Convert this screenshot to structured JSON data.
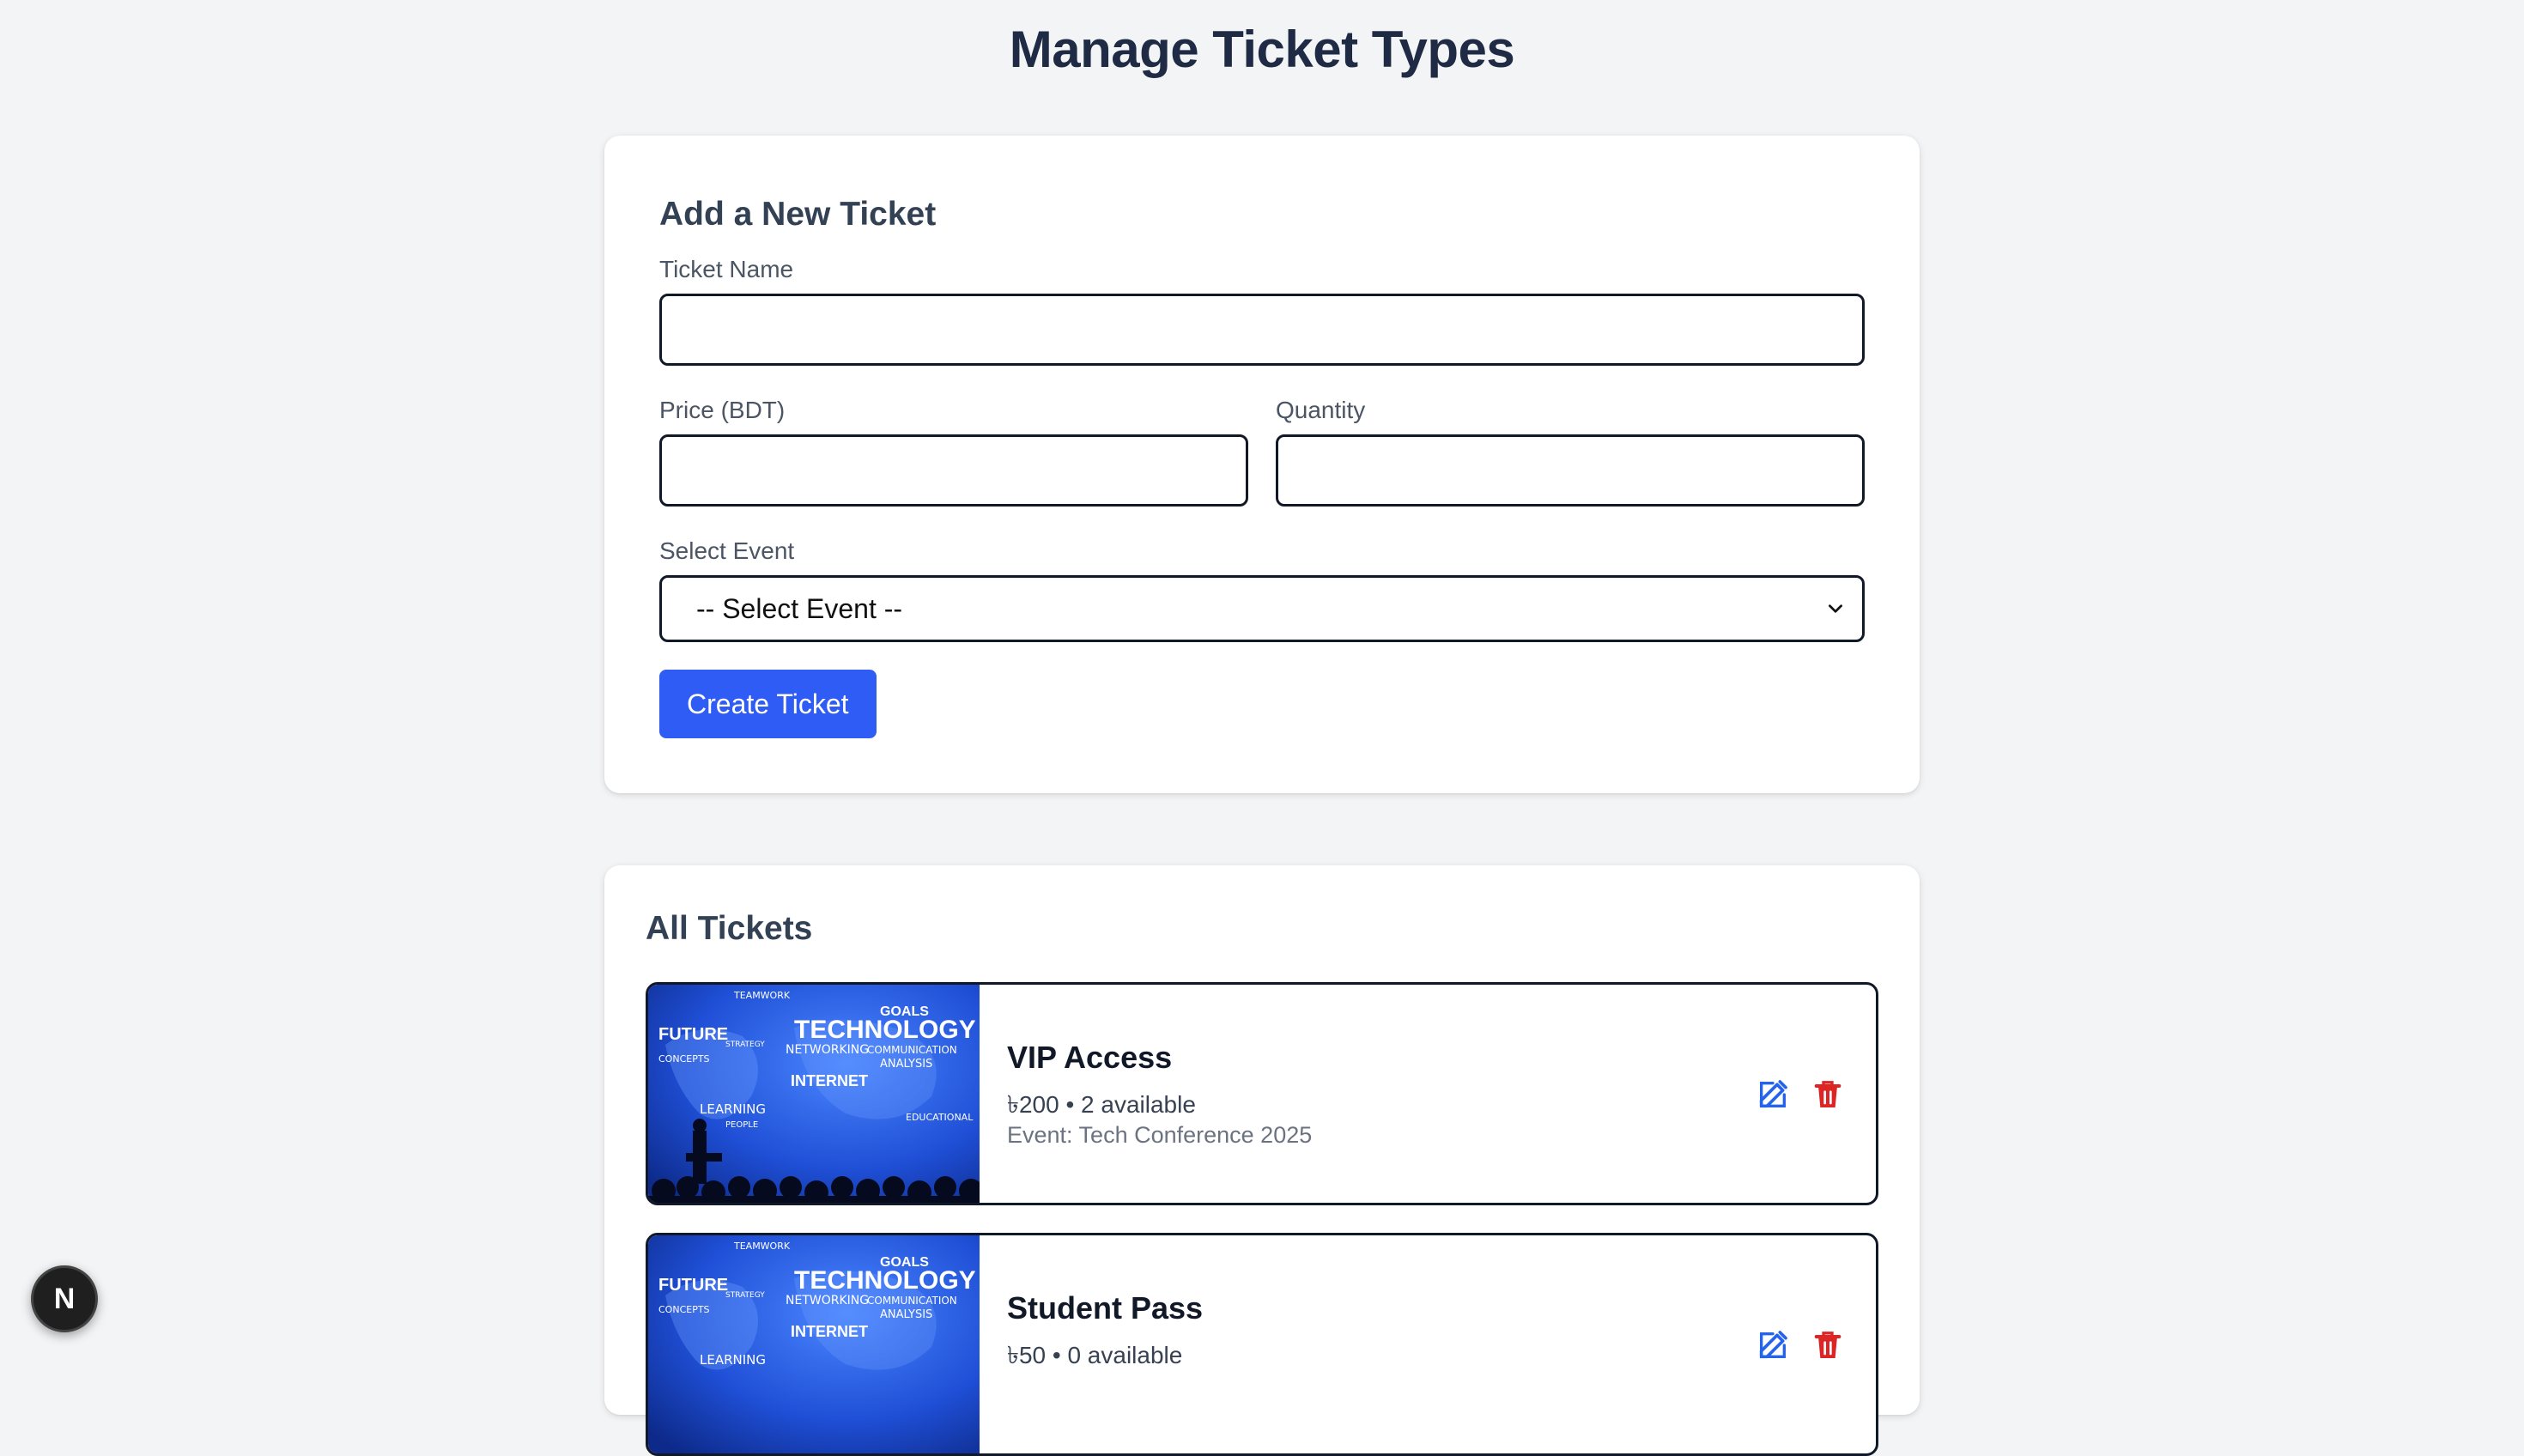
{
  "page": {
    "title": "Manage Ticket Types"
  },
  "form": {
    "title": "Add a New Ticket",
    "ticket_name_label": "Ticket Name",
    "ticket_name_value": "",
    "price_label": "Price (BDT)",
    "price_value": "",
    "quantity_label": "Quantity",
    "quantity_value": "",
    "event_label": "Select Event",
    "event_selected": "-- Select Event --",
    "submit_label": "Create Ticket"
  },
  "list": {
    "title": "All Tickets",
    "tickets": [
      {
        "name": "VIP Access",
        "meta": "৳200 • 2 available",
        "event": "Event: Tech Conference 2025"
      },
      {
        "name": "Student Pass",
        "meta": "৳50 • 0 available",
        "event": ""
      }
    ]
  },
  "image": {
    "words": [
      "TEAMWORK",
      "TECHNOLOGY",
      "GOALS",
      "FUTURE",
      "NETWORKING",
      "COMMUNICATION",
      "INTERNET",
      "ANALYSIS",
      "LEARNING",
      "EDUCATIONAL",
      "STRATEGY",
      "CONCEPTS",
      "PEOPLE"
    ]
  },
  "colors": {
    "primary": "#2f5cf5",
    "edit": "#2563eb",
    "delete": "#dc2626"
  },
  "icons": {
    "edit": "edit-icon",
    "delete": "trash-icon",
    "badge": "N"
  }
}
